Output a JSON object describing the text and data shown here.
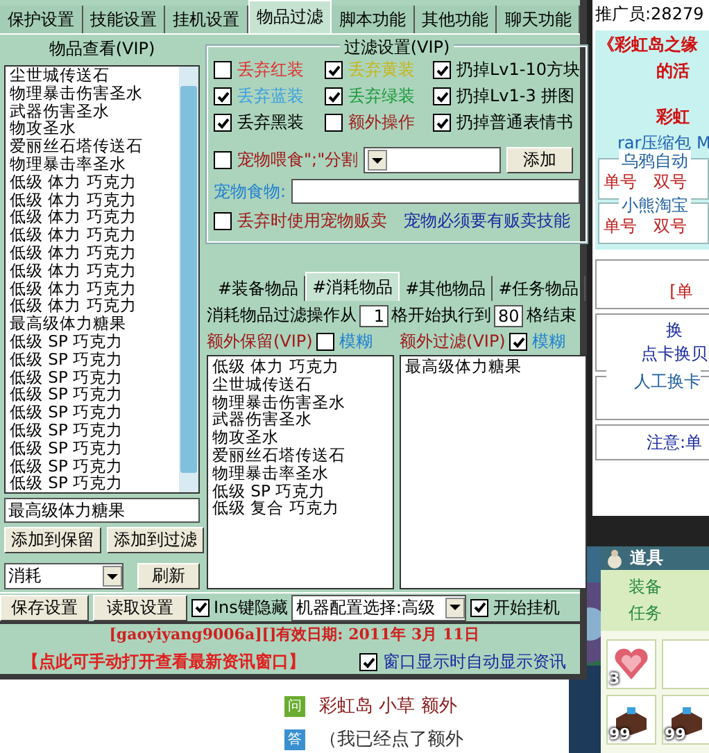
{
  "main_window": {
    "tabs": [
      {
        "label": "保护设置",
        "selected": false
      },
      {
        "label": "技能设置",
        "selected": false
      },
      {
        "label": "挂机设置",
        "selected": false
      },
      {
        "label": "物品过滤",
        "selected": true
      },
      {
        "label": "脚本功能",
        "selected": false
      },
      {
        "label": "其他功能",
        "selected": false
      },
      {
        "label": "聊天功能",
        "selected": false
      }
    ],
    "item_view": {
      "title": "物品查看(VIP)",
      "items": [
        "尘世城传送石",
        "物理暴击伤害圣水",
        "武器伤害圣水",
        "物攻圣水",
        "爱丽丝石塔传送石",
        "物理暴击率圣水",
        "低级 体力 巧克力",
        "低级 体力 巧克力",
        "低级 体力 巧克力",
        "低级 体力 巧克力",
        "低级 体力 巧克力",
        "低级 体力 巧克力",
        "低级 体力 巧克力",
        "低级 体力 巧克力",
        "最高级体力糖果",
        "低级 SP 巧克力",
        "低级 SP 巧克力",
        "低级 SP 巧克力",
        "低级 SP 巧克力",
        "低级 SP 巧克力",
        "低级 SP 巧克力",
        "低级 SP 巧克力",
        "低级 SP 巧克力",
        "低级 SP 巧克力"
      ],
      "name_field": {
        "value": "最高级体力糖果"
      },
      "buttons": [
        "添加到保留",
        "添加到过滤"
      ],
      "category_select": {
        "value": "消耗"
      },
      "refresh_button": "刷新"
    },
    "filter_settings": {
      "title": "过滤设置(VIP)",
      "checkboxes": [
        {
          "label": "丢弃红装",
          "checked": false,
          "color": "#e03030"
        },
        {
          "label": "丢弃黄装",
          "checked": true,
          "color": "#c8b418"
        },
        {
          "label": "扔掉Lv1-10方块",
          "checked": true,
          "color": "#000000"
        },
        {
          "label": "丢弃蓝装",
          "checked": true,
          "color": "#3a9ee0"
        },
        {
          "label": "丢弃绿装",
          "checked": true,
          "color": "#1a9a3a"
        },
        {
          "label": "扔掉Lv1-3 拼图",
          "checked": true,
          "color": "#000000"
        },
        {
          "label": "丢弃黑装",
          "checked": true,
          "color": "#000000"
        },
        {
          "label": "额外操作",
          "checked": false,
          "color": "#a02020"
        },
        {
          "label": "扔掉普通表情书",
          "checked": true,
          "color": "#000000"
        }
      ],
      "pet_feed": {
        "label": "宠物喂食\";\"分割",
        "checked": false,
        "add_button": "添加"
      },
      "pet_food_label": "宠物食物:",
      "sell_option": {
        "label": "丢弃时使用宠物贩卖",
        "checked": false
      },
      "sell_note": "宠物必须要有贩卖技能"
    },
    "item_tabs": [
      {
        "label": "#装备物品",
        "selected": false
      },
      {
        "label": "#消耗物品",
        "selected": true
      },
      {
        "label": "#其他物品",
        "selected": false
      },
      {
        "label": "#任务物品",
        "selected": false
      }
    ],
    "range": {
      "prefix": "消耗物品过滤操作从",
      "from": "1",
      "middle": "格开始执行到",
      "to": "80",
      "suffix": "格结束"
    },
    "keep_list": {
      "title": "额外保留(VIP)",
      "fuzzy": {
        "label": "模糊",
        "checked": false
      },
      "items": [
        "低级 体力 巧克力",
        "尘世城传送石",
        "物理暴击伤害圣水",
        "武器伤害圣水",
        "物攻圣水",
        "爱丽丝石塔传送石",
        "物理暴击率圣水",
        "低级 SP 巧克力",
        "低级 复合 巧克力"
      ]
    },
    "filter_list": {
      "title": "额外过滤(VIP)",
      "fuzzy": {
        "label": "模糊",
        "checked": true
      },
      "items": [
        "最高级体力糖果"
      ]
    },
    "toolbar": {
      "save_button": "保存设置",
      "load_button": "读取设置",
      "hide": {
        "label": "Ins键隐藏",
        "checked": true
      },
      "machine_select": "机器配置选择:高级",
      "start": {
        "label": "开始挂机",
        "checked": true
      }
    },
    "status": {
      "license": "[gaoyiyang9006a][]有效日期: 2011年 3月 11日",
      "news_link": "【点此可手动打开查看最新资讯窗口】",
      "auto_news": {
        "label": "窗口显示时自动显示资讯",
        "checked": true
      }
    }
  },
  "side_window": {
    "promoter": "推广员:28279",
    "headline": [
      "《彩虹岛之缘",
      "的活"
    ],
    "highlight": "彩虹",
    "download_link": "rar压缩包 M",
    "groups": [
      {
        "title": "乌鸦自动",
        "links": [
          "单号",
          "双号"
        ]
      },
      {
        "title": "小熊淘宝",
        "links": [
          "单号",
          "双号"
        ]
      }
    ],
    "box_texts": [
      "[单",
      "换",
      "点卡换贝"
    ],
    "manual_title": "人工换卡",
    "notice": "注意:单"
  },
  "game_panel": {
    "title": "道具",
    "tabs": [
      "装备",
      "任务"
    ],
    "slots": [
      {
        "kind": "heart",
        "count": "3"
      },
      {
        "kind": "empty"
      },
      {
        "kind": "chest",
        "count": "99"
      },
      {
        "kind": "chest",
        "count": "99"
      }
    ]
  },
  "web_page": {
    "qa": [
      {
        "kind": "question",
        "badge": "问",
        "text": "彩虹岛 小草 额外"
      },
      {
        "kind": "answer",
        "badge": "答",
        "text": "（我已经点了额外"
      }
    ]
  }
}
